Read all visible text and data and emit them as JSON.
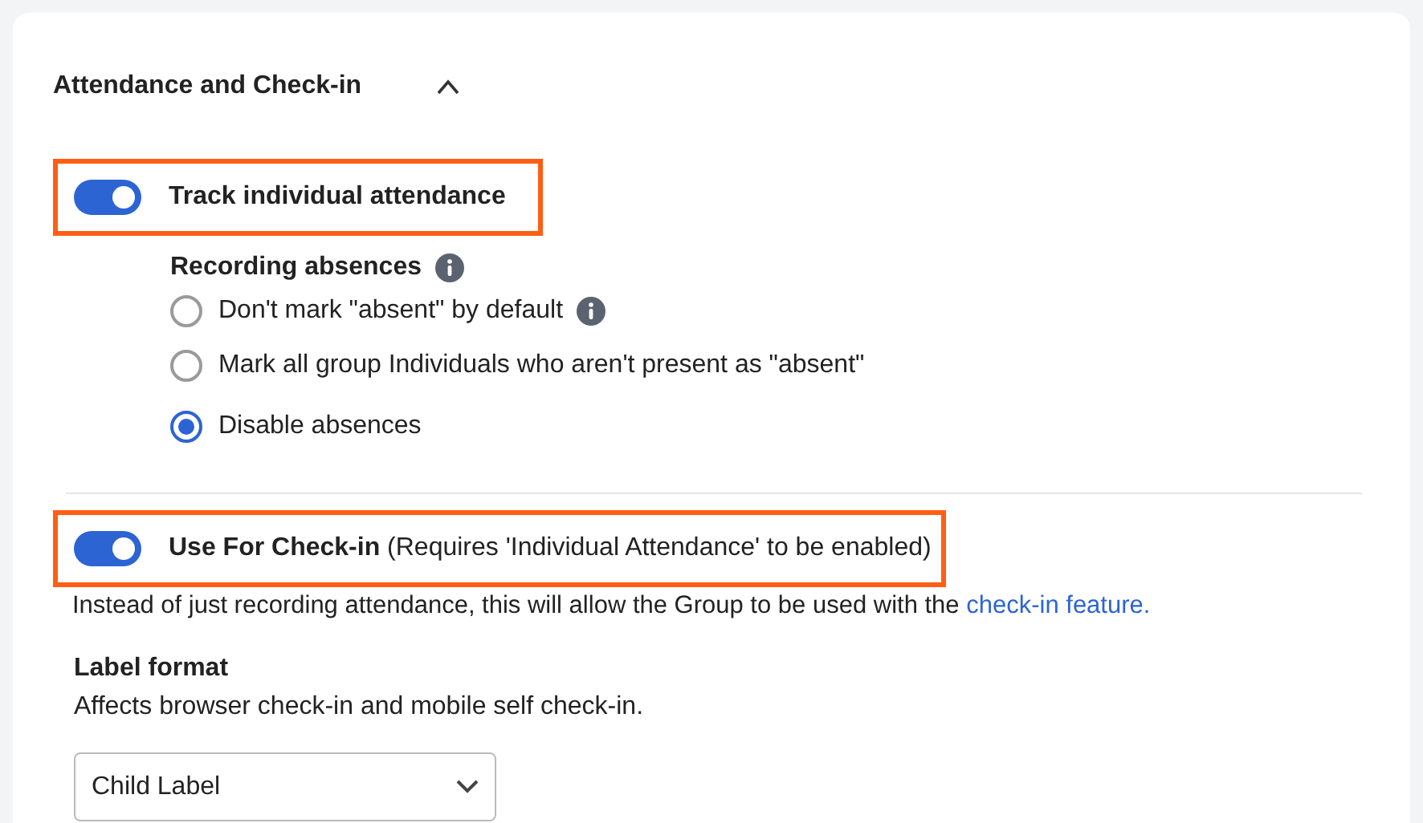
{
  "section": {
    "title": "Attendance and Check-in",
    "expanded": true
  },
  "track_attendance": {
    "label": "Track individual attendance",
    "on": true,
    "highlighted": true
  },
  "recording_absences": {
    "label": "Recording absences",
    "options": [
      {
        "label": "Don't mark \"absent\" by default",
        "selected": false,
        "info": true
      },
      {
        "label": "Mark all group Individuals who aren't present as \"absent\"",
        "selected": false,
        "info": false
      },
      {
        "label": "Disable absences",
        "selected": true,
        "info": false
      }
    ]
  },
  "check_in": {
    "label": "**Use For Check-in** (Requires 'Individual Attendance' to be enabled)",
    "on": true,
    "highlighted": true,
    "description": "Instead of just recording attendance, this will allow the Group to be used with the",
    "link": "check-in feature."
  },
  "label_format": {
    "label": "Label format",
    "help": "Affects browser check-in and mobile self check-in.",
    "value": "Child Label"
  }
}
